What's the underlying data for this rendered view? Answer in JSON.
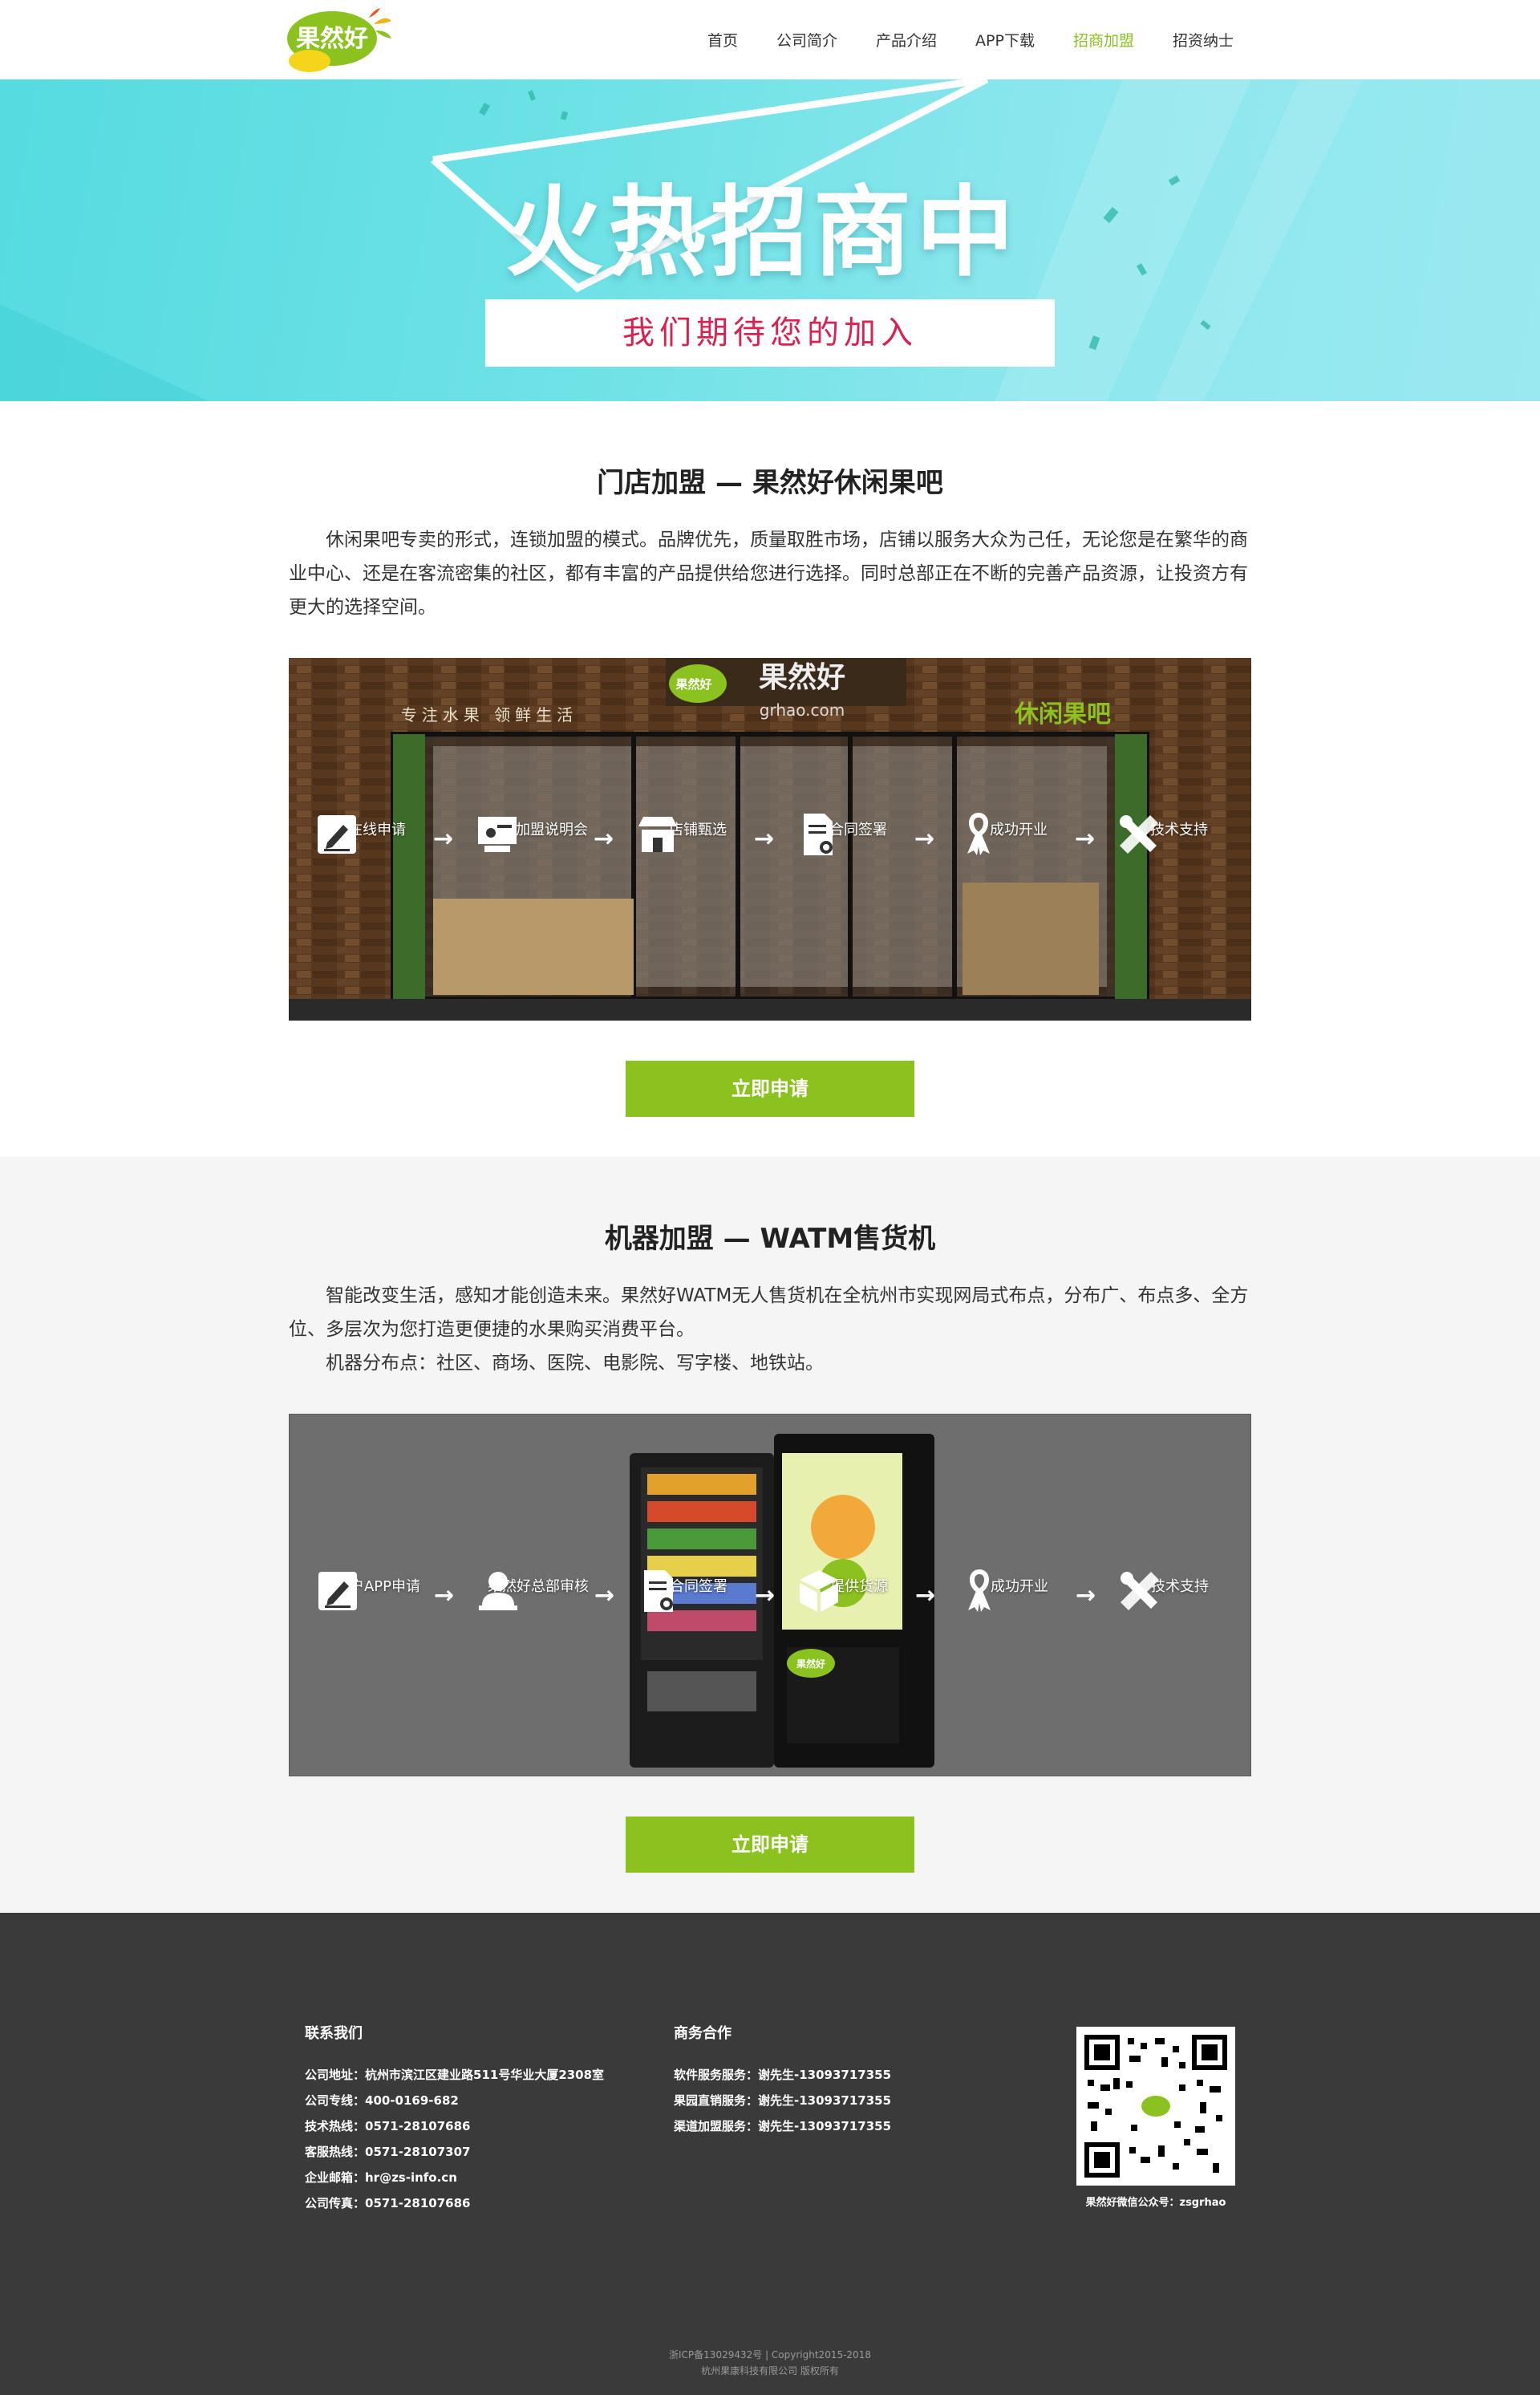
{
  "nav": {
    "logo_text": "果然好",
    "items": [
      {
        "label": "首页"
      },
      {
        "label": "公司简介"
      },
      {
        "label": "产品介绍"
      },
      {
        "label": "APP下载"
      },
      {
        "label": "招商加盟"
      },
      {
        "label": "招资纳士"
      }
    ],
    "active_color": "#8cc21f"
  },
  "banner": {
    "title": "火热招商中",
    "subtitle": "我们期待您的加入"
  },
  "store": {
    "title": "门店加盟 — 果然好休闲果吧",
    "paragraph": "休闲果吧专卖的形式，连锁加盟的模式。品牌优先，质量取胜市场，店铺以服务大众为己任，无论您是在繁华的商业中心、还是在客流密集的社区，都有丰富的产品提供给您进行选择。同时总部正在不断的完善产品资源，让投资方有更大的选择空间。",
    "sign_brand": "果然好",
    "sign_url": "grhao.com",
    "sign_left": "专注水果 领鲜生活",
    "sign_right": "休闲果吧",
    "steps": [
      {
        "label": "在线申请",
        "icon": "edit-icon"
      },
      {
        "label": "参加加盟说明会",
        "icon": "presentation-icon"
      },
      {
        "label": "店铺甄选",
        "icon": "shop-icon"
      },
      {
        "label": "合同签署",
        "icon": "contract-icon"
      },
      {
        "label": "成功开业",
        "icon": "ribbon-icon"
      },
      {
        "label": "技术支持",
        "icon": "tools-icon"
      }
    ],
    "button": "立即申请"
  },
  "machine": {
    "title": "机器加盟 — WATM售货机",
    "paragraph1": "智能改变生活，感知才能创造未来。果然好WATM无人售货机在全杭州市实现网局式布点，分布广、布点多、全方位、多层次为您打造更便捷的水果购买消费平台。",
    "paragraph2": "机器分布点：社区、商场、医院、电影院、写字楼、地铁站。",
    "steps": [
      {
        "label": "商户APP申请",
        "icon": "edit-icon"
      },
      {
        "label": "果然好总部审核",
        "icon": "user-icon"
      },
      {
        "label": "合同签署",
        "icon": "contract-icon"
      },
      {
        "label": "提供货源",
        "icon": "box-icon"
      },
      {
        "label": "成功开业",
        "icon": "ribbon-icon"
      },
      {
        "label": "技术支持",
        "icon": "tools-icon"
      }
    ],
    "button": "立即申请"
  },
  "footer": {
    "contact": {
      "title": "联系我们",
      "rows": [
        "公司地址：杭州市滨江区建业路511号华业大厦2308室",
        "公司专线：400-0169-682",
        "技术热线：0571-28107686",
        "客服热线：0571-28107307",
        "企业邮箱：hr@zs-info.cn",
        "公司传真：0571-28107686"
      ]
    },
    "business": {
      "title": "商务合作",
      "rows": [
        "软件服务服务：谢先生-13093717355",
        "果园直销服务：谢先生-13093717355",
        "渠道加盟服务：谢先生-13093717355"
      ]
    },
    "qr_caption": "果然好微信公众号：zsgrhao",
    "icp": "浙ICP备13029432号 | Copyright2015-2018",
    "company": "杭州果康科技有限公司 版权所有"
  }
}
